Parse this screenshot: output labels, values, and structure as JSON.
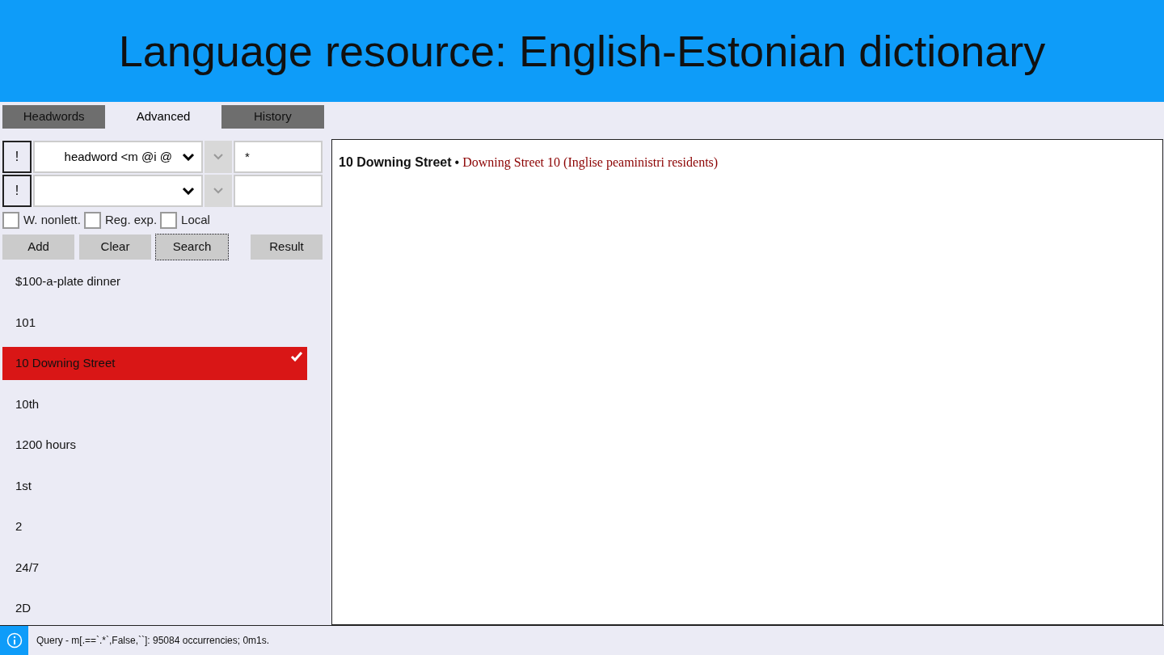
{
  "header": {
    "title": "Language resource: English-Estonian dictionary"
  },
  "tabs": [
    {
      "label": "Headwords",
      "selected": false
    },
    {
      "label": "Advanced",
      "selected": true
    },
    {
      "label": "History",
      "selected": false
    }
  ],
  "query_rows": [
    {
      "not_label": "!",
      "field": "headword <m @i @",
      "value": "*"
    },
    {
      "not_label": "!",
      "field": "",
      "value": ""
    }
  ],
  "options": [
    {
      "label": "W. nonlett.",
      "checked": false
    },
    {
      "label": "Reg. exp.",
      "checked": false
    },
    {
      "label": "Local",
      "checked": false
    }
  ],
  "buttons": [
    {
      "label": "Add",
      "focused": false
    },
    {
      "label": "Clear",
      "focused": false
    },
    {
      "label": "Search",
      "focused": true
    },
    {
      "label": "Result",
      "focused": false
    }
  ],
  "results": [
    {
      "label": "$100-a-plate dinner",
      "selected": false
    },
    {
      "label": "101",
      "selected": false
    },
    {
      "label": "10 Downing Street",
      "selected": true
    },
    {
      "label": "10th",
      "selected": false
    },
    {
      "label": "1200 hours",
      "selected": false
    },
    {
      "label": "1st",
      "selected": false
    },
    {
      "label": "2",
      "selected": false
    },
    {
      "label": "24/7",
      "selected": false
    },
    {
      "label": "2D",
      "selected": false
    }
  ],
  "entry": {
    "headword": "10 Downing Street",
    "separator": "•",
    "translation": "Downing Street 10 (Inglise peaministri residents)"
  },
  "status_bar": {
    "message": "Query - m[.==`.*`,False,``]: 95084 occurrencies; 0m1s."
  }
}
